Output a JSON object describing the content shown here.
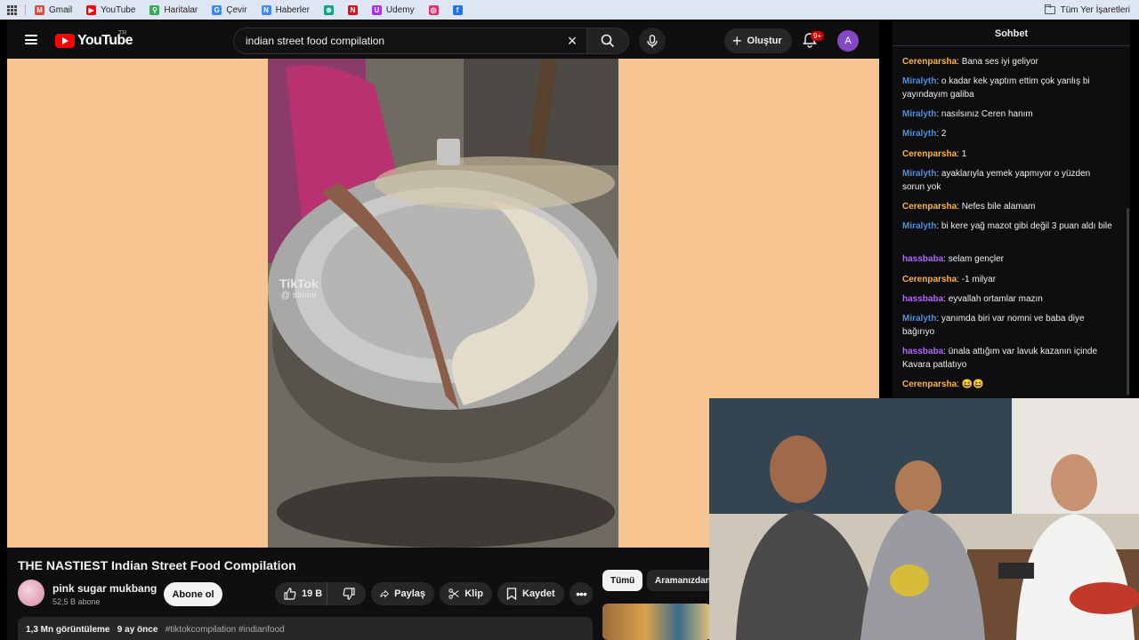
{
  "bookmarks": {
    "items": [
      {
        "label": "Gmail",
        "icon": "gmail-icon",
        "color": "#ea4335",
        "glyph": "M"
      },
      {
        "label": "YouTube",
        "icon": "youtube-icon",
        "color": "#ff0000",
        "glyph": "▶"
      },
      {
        "label": "Haritalar",
        "icon": "maps-icon",
        "color": "#34a853",
        "glyph": "⚲"
      },
      {
        "label": "Çevir",
        "icon": "translate-icon",
        "color": "#4285f4",
        "glyph": "G"
      },
      {
        "label": "Haberler",
        "icon": "news-icon",
        "color": "#4285f4",
        "glyph": "N"
      },
      {
        "label": "",
        "icon": "chatgpt-icon",
        "color": "#10a37f",
        "glyph": "⊛"
      },
      {
        "label": "",
        "icon": "netflix-icon",
        "color": "#e50914",
        "glyph": "N"
      },
      {
        "label": "Udemy",
        "icon": "udemy-icon",
        "color": "#a435f0",
        "glyph": "U"
      },
      {
        "label": "",
        "icon": "instagram-icon",
        "color": "#e1306c",
        "glyph": "◎"
      },
      {
        "label": "",
        "icon": "facebook-icon",
        "color": "#1877f2",
        "glyph": "f"
      }
    ],
    "all_bookmarks": "Tüm Yer İşaretleri"
  },
  "youtube": {
    "logo_text": "YouTube",
    "country": "TR",
    "search_value": "indian street food compilation",
    "create_label": "Oluştur",
    "notif_badge": "9+",
    "avatar_letter": "A",
    "watermark": "TikTok",
    "watermark_user": "@ stmnir",
    "video_title": "THE NASTIEST Indian Street Food Compilation",
    "channel_name": "pink sugar mukbang",
    "subscribers": "52,5 B abone",
    "subscribe_label": "Abone ol",
    "likes": "19 B",
    "share_label": "Paylaş",
    "clip_label": "Klip",
    "save_label": "Kaydet",
    "more_label": "•••",
    "views": "1,3 Mn görüntüleme",
    "age": "9 ay önce",
    "tags": "#tiktokcompilation #indianfood",
    "chip_all": "Tümü",
    "chip_search": "Aramanızdan"
  },
  "chat": {
    "title": "Sohbet",
    "messages": [
      {
        "user": "Cerenparsha",
        "type": "c",
        "text": "Bana ses iyi geliyor"
      },
      {
        "user": "Miralyth",
        "type": "m",
        "text": "o kadar kek yaptım ettim çok yanlış bi yayındayım galiba"
      },
      {
        "user": "Miralyth",
        "type": "m",
        "text": "nasılsınız Ceren hanım"
      },
      {
        "user": "Miralyth",
        "type": "m",
        "text": "2"
      },
      {
        "user": "Cerenparsha",
        "type": "c",
        "text": "1"
      },
      {
        "user": "Miralyth",
        "type": "m",
        "text": "ayaklarıyla yemek yapmıyor o yüzden sorun yok"
      },
      {
        "user": "Cerenparsha",
        "type": "c",
        "text": "Nefes bile alamam"
      },
      {
        "user": "Miralyth",
        "type": "m",
        "text": "bi kere yağ mazot gibi değil 3 puan aldı bile"
      },
      {
        "user": "hassbaba",
        "type": "h",
        "text": "selam gençler"
      },
      {
        "user": "Cerenparsha",
        "type": "c",
        "text": "-1 milyar"
      },
      {
        "user": "hassbaba",
        "type": "h",
        "text": "eyvallah ortamlar mazın"
      },
      {
        "user": "Miralyth",
        "type": "m",
        "text": "yanımda biri var nomni ve baba diye bağırıyo"
      },
      {
        "user": "hassbaba",
        "type": "h",
        "text": "ünala attığım var lavuk kazanın içinde Kavara patlatıyo"
      },
      {
        "user": "Cerenparsha",
        "type": "c",
        "text": "😆😆"
      }
    ]
  }
}
